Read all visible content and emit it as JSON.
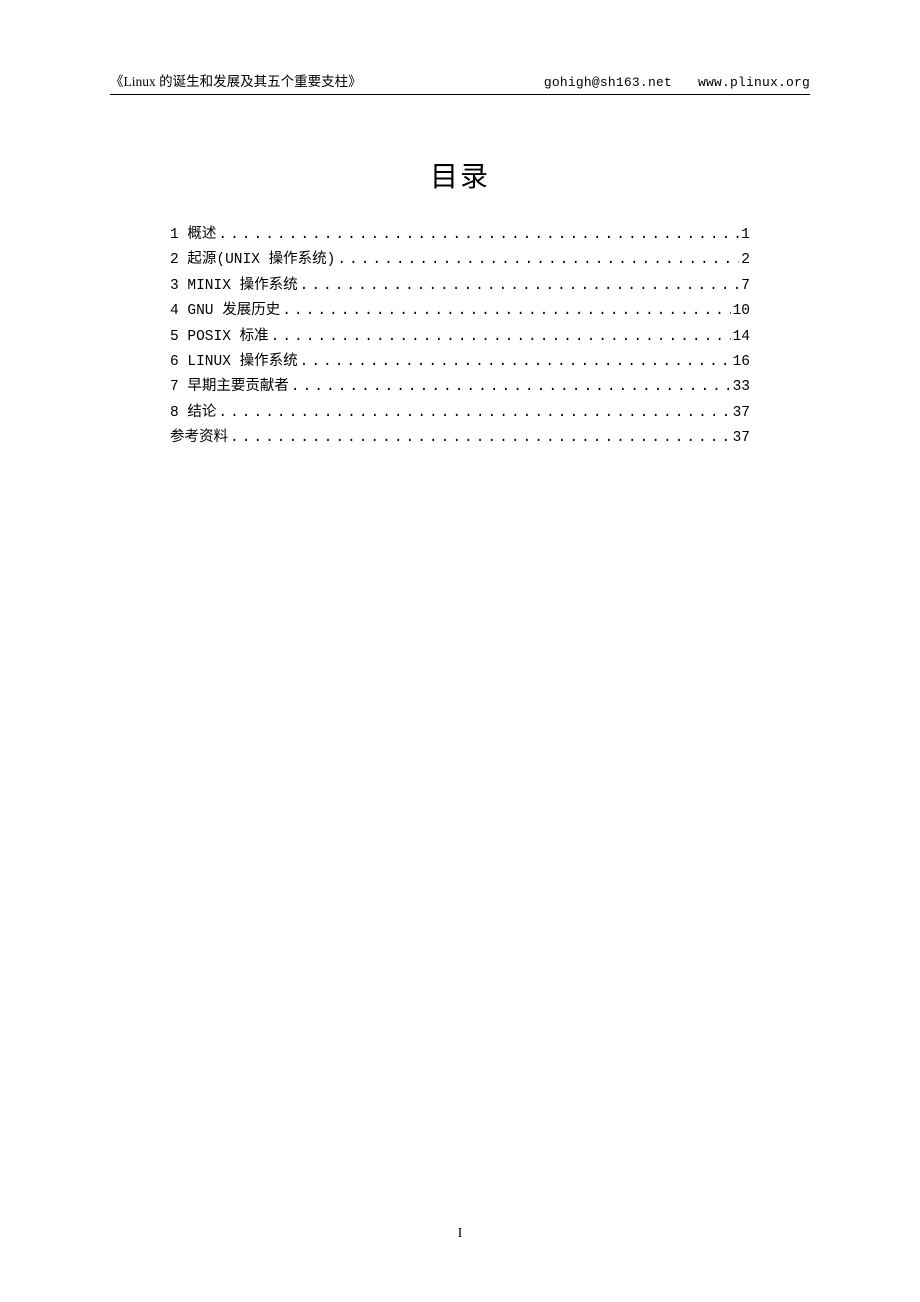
{
  "header": {
    "title": "《Linux 的诞生和发展及其五个重要支柱》",
    "email": "gohigh@sh163.net",
    "website": "www.plinux.org"
  },
  "toc": {
    "title": "目录",
    "entries": [
      {
        "label": "1 概述",
        "page": "1"
      },
      {
        "label": "2 起源(UNIX 操作系统)",
        "page": "2"
      },
      {
        "label": "3 MINIX 操作系统",
        "page": "7"
      },
      {
        "label": "4 GNU 发展历史",
        "page": "10"
      },
      {
        "label": "5 POSIX 标准",
        "page": "14"
      },
      {
        "label": "6 LINUX 操作系统",
        "page": "16"
      },
      {
        "label": "7 早期主要贡献者",
        "page": "33"
      },
      {
        "label": "8 结论",
        "page": "37"
      },
      {
        "label": "参考资料",
        "page": "37"
      }
    ]
  },
  "page_number": "I"
}
